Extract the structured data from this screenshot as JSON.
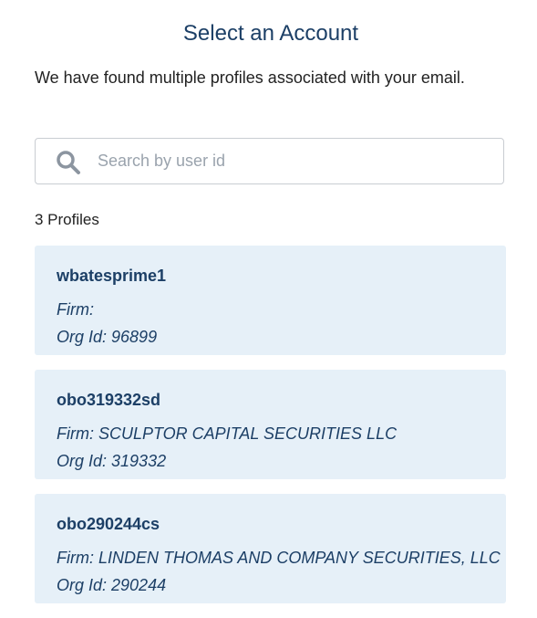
{
  "header": {
    "title": "Select an Account",
    "message": "We have found multiple profiles associated with your email."
  },
  "search": {
    "placeholder": "Search by user id",
    "value": "",
    "icon": "search-icon"
  },
  "profiles_count_label": "3 Profiles",
  "profiles": [
    {
      "user_id": "wbatesprime1",
      "firm": "Firm:",
      "org_id": "Org Id: 96899"
    },
    {
      "user_id": "obo319332sd",
      "firm": "Firm: SCULPTOR CAPITAL SECURITIES LLC",
      "org_id": "Org Id: 319332"
    },
    {
      "user_id": "obo290244cs",
      "firm": "Firm: LINDEN THOMAS AND COMPANY SECURITIES, LLC",
      "org_id": "Org Id: 290244"
    }
  ],
  "colors": {
    "title": "#1c3f66",
    "card_background": "#e6f0f8",
    "search_border": "#c9cdd2",
    "placeholder": "#9aa3ad",
    "icon": "#8c95a0"
  }
}
